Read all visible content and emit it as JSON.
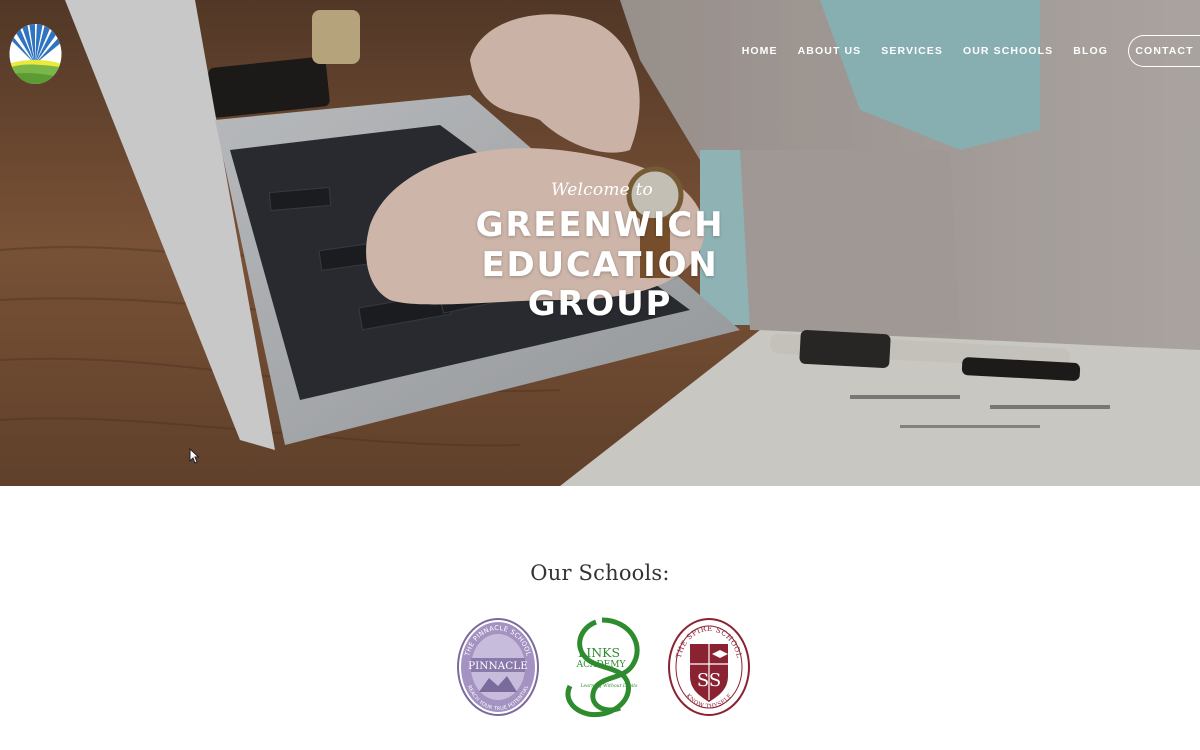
{
  "brand": {
    "logo_icon": "sunburst-hills-icon",
    "colors": {
      "sky_blue": "#2f74c0",
      "hill_green": "#7ab648",
      "sun_yellow": "#e9ea3b"
    }
  },
  "nav": {
    "items": [
      {
        "label": "HOME"
      },
      {
        "label": "ABOUT US"
      },
      {
        "label": "SERVICES"
      },
      {
        "label": "OUR SCHOOLS"
      },
      {
        "label": "BLOG"
      }
    ],
    "contact_label": "CONTACT"
  },
  "hero": {
    "welcome": "Welcome to",
    "title_lines": [
      "GREENWICH",
      "EDUCATION",
      "GROUP"
    ],
    "background_icon": "laptop-typing-photo"
  },
  "schools": {
    "heading": "Our Schools:",
    "items": [
      {
        "name": "PINNACLE",
        "ring_text_top": "THE PINNACLE SCHOOL",
        "ring_text_bottom": "REACH YOUR TRUE POTENTIAL",
        "color": "#7b6a9c"
      },
      {
        "name_line1": "LINKS",
        "name_line2": "ACADEMY",
        "tagline": "Learning Without Limits",
        "color": "#2e8b2e"
      },
      {
        "ring_text_top": "THE SPIRE SCHOOL",
        "ring_text_bottom": "KNOW THYSELF",
        "monogram": "SS",
        "color": "#8b2232"
      }
    ]
  }
}
